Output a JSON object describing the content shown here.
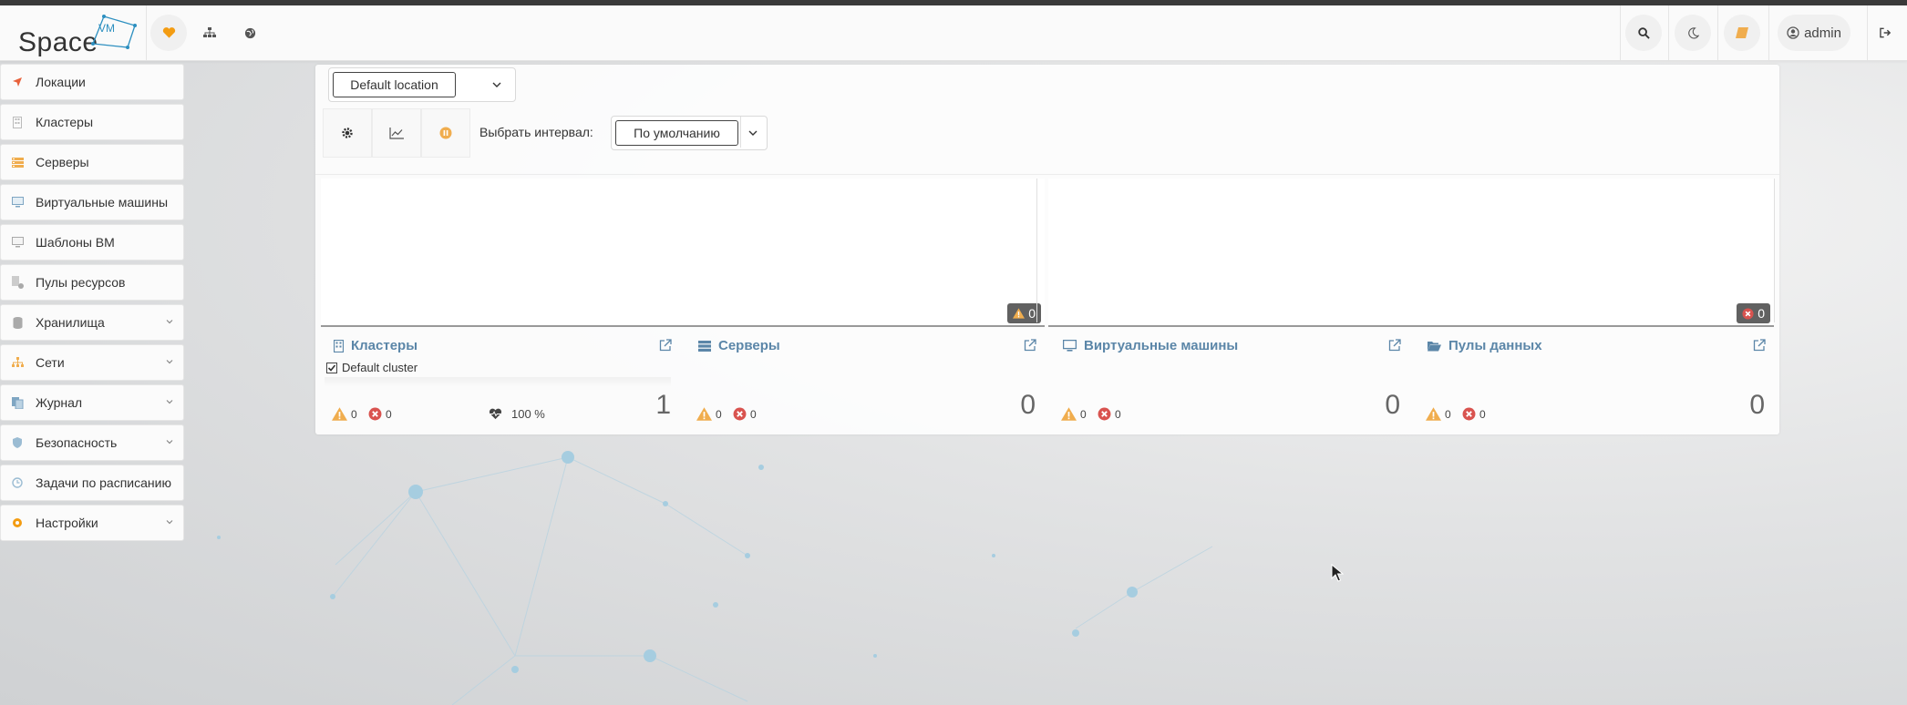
{
  "app": {
    "logo_text": "Space",
    "logo_badge": "VM"
  },
  "header": {
    "user_label": "admin",
    "icons": [
      "heart-icon",
      "sitemap-icon",
      "globe-icon",
      "search-icon",
      "moon-icon",
      "note-icon",
      "user-circle-icon",
      "logout-icon"
    ]
  },
  "sidebar": {
    "items": [
      {
        "label": "Локации",
        "icon": "location-arrow-icon",
        "expandable": false
      },
      {
        "label": "Кластеры",
        "icon": "building-icon",
        "expandable": false
      },
      {
        "label": "Серверы",
        "icon": "server-icon",
        "expandable": false
      },
      {
        "label": "Виртуальные машины",
        "icon": "desktop-icon",
        "expandable": false
      },
      {
        "label": "Шаблоны ВМ",
        "icon": "desktop-template-icon",
        "expandable": false
      },
      {
        "label": "Пулы ресурсов",
        "icon": "resource-pool-icon",
        "expandable": false
      },
      {
        "label": "Хранилища",
        "icon": "database-icon",
        "expandable": true
      },
      {
        "label": "Сети",
        "icon": "network-icon",
        "expandable": true
      },
      {
        "label": "Журнал",
        "icon": "copy-icon",
        "expandable": true
      },
      {
        "label": "Безопасность",
        "icon": "shield-icon",
        "expandable": true
      },
      {
        "label": "Задачи по расписанию",
        "icon": "clock-icon",
        "expandable": false
      },
      {
        "label": "Настройки",
        "icon": "cog-icon",
        "expandable": true
      }
    ]
  },
  "toolbar": {
    "location_value": "Default location",
    "interval_label": "Выбрать интервал:",
    "interval_value": "По умолчанию"
  },
  "charts": {
    "left_badge_count": "0",
    "right_badge_count": "0"
  },
  "cards": [
    {
      "title": "Кластеры",
      "count": "1",
      "warnings": "0",
      "errors": "0",
      "sub_item": "Default cluster",
      "health": "100 %"
    },
    {
      "title": "Серверы",
      "count": "0",
      "warnings": "0",
      "errors": "0"
    },
    {
      "title": "Виртуальные машины",
      "count": "0",
      "warnings": "0",
      "errors": "0"
    },
    {
      "title": "Пулы данных",
      "count": "0",
      "warnings": "0",
      "errors": "0"
    }
  ],
  "colors": {
    "accent_blue": "#5b86a8",
    "warning": "#f0ad4e",
    "error": "#d9534f",
    "orange": "#f39c12"
  }
}
